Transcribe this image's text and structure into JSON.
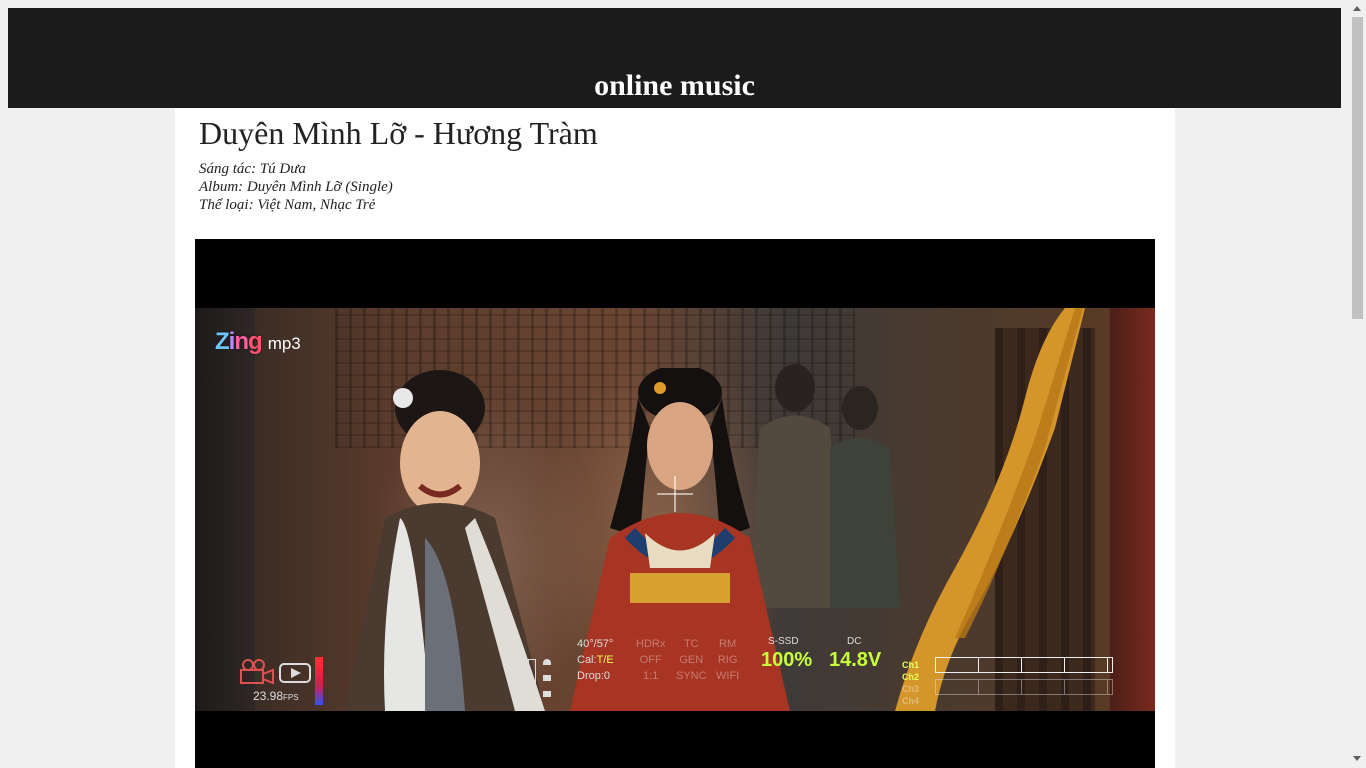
{
  "header": {
    "title": "online music"
  },
  "song": {
    "title": "Duyên Mình Lỡ - Hương Tràm",
    "composer": "Sáng tác: Tú Dưa",
    "album": "Album: Duyên Mình Lỡ (Single)",
    "genre": "Thể loại: Việt Nam, Nhạc Trẻ"
  },
  "video": {
    "logo_brand": "Zing",
    "logo_suffix": "mp3",
    "hud": {
      "fps_value": "23.98",
      "fps_unit": "FPS",
      "angle": "40°/57°",
      "cal_label": "Cal:",
      "cal_value": "T/E",
      "drop": "Drop:0",
      "hdr_label": "HDRx",
      "hdr_value": "OFF",
      "ratio": "1:1",
      "tc_label": "TC",
      "tc_value": "GEN",
      "tc_sync": "SYNC",
      "rm_label": "RM",
      "rm_value": "RIG",
      "rm_wifi": "WIFI",
      "storage_label": "S-SSD",
      "storage_value": "100%",
      "power_label": "DC",
      "power_value": "14.8V",
      "channels": [
        "Ch1",
        "Ch2",
        "Ch3",
        "Ch4"
      ]
    }
  },
  "colors": {
    "header_bg": "#1b1b1b",
    "page_bg": "#f0f0f0",
    "content_bg": "#ffffff",
    "hud_accent": "#c7ff3a"
  }
}
